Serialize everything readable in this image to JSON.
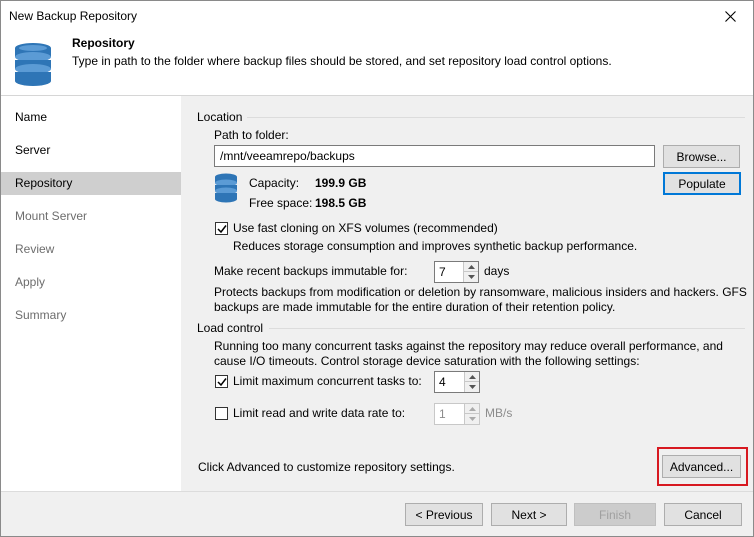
{
  "window": {
    "title": "New Backup Repository"
  },
  "header": {
    "title": "Repository",
    "description": "Type in path to the folder where backup files should be stored, and set repository load control options.",
    "icon": "database-icon"
  },
  "sidebar": {
    "items": [
      {
        "label": "Name",
        "state": "done"
      },
      {
        "label": "Server",
        "state": "done"
      },
      {
        "label": "Repository",
        "state": "active"
      },
      {
        "label": "Mount Server",
        "state": "pending"
      },
      {
        "label": "Review",
        "state": "pending"
      },
      {
        "label": "Apply",
        "state": "pending"
      },
      {
        "label": "Summary",
        "state": "pending"
      }
    ]
  },
  "location": {
    "section_label": "Location",
    "path_label": "Path to folder:",
    "path_value": "/mnt/veeamrepo/backups",
    "browse_label": "Browse...",
    "populate_label": "Populate",
    "capacity_label": "Capacity:",
    "capacity_value": "199.9 GB",
    "free_label": "Free space:",
    "free_value": "198.5 GB",
    "fast_clone_label": "Use fast cloning on XFS volumes (recommended)",
    "fast_clone_checked": true,
    "fast_clone_desc": "Reduces storage consumption and improves synthetic backup performance.",
    "immutable_label": "Make recent backups immutable for:",
    "immutable_value": "7",
    "immutable_unit": "days",
    "immutable_desc_1": "Protects backups from modification or deletion by ransomware, malicious insiders and hackers. GFS",
    "immutable_desc_2": "backups are made immutable for the entire duration of their retention policy."
  },
  "load_control": {
    "section_label": "Load control",
    "desc_1": "Running too many concurrent tasks against the repository may reduce overall performance, and",
    "desc_2": "cause I/O timeouts. Control storage device saturation with the following settings:",
    "limit_tasks_label": "Limit maximum concurrent tasks to:",
    "limit_tasks_checked": true,
    "limit_tasks_value": "4",
    "limit_rate_label": "Limit read and write data rate to:",
    "limit_rate_checked": false,
    "limit_rate_value": "1",
    "limit_rate_unit": "MB/s"
  },
  "advanced": {
    "hint": "Click Advanced to customize repository settings.",
    "button_label": "Advanced..."
  },
  "footer": {
    "previous_label": "< Previous",
    "next_label": "Next >",
    "finish_label": "Finish",
    "cancel_label": "Cancel"
  },
  "colors": {
    "accent": "#0078d7",
    "highlight": "#d71920",
    "db_icon": "#2e75b6",
    "active_nav": "#cfcfcf"
  }
}
